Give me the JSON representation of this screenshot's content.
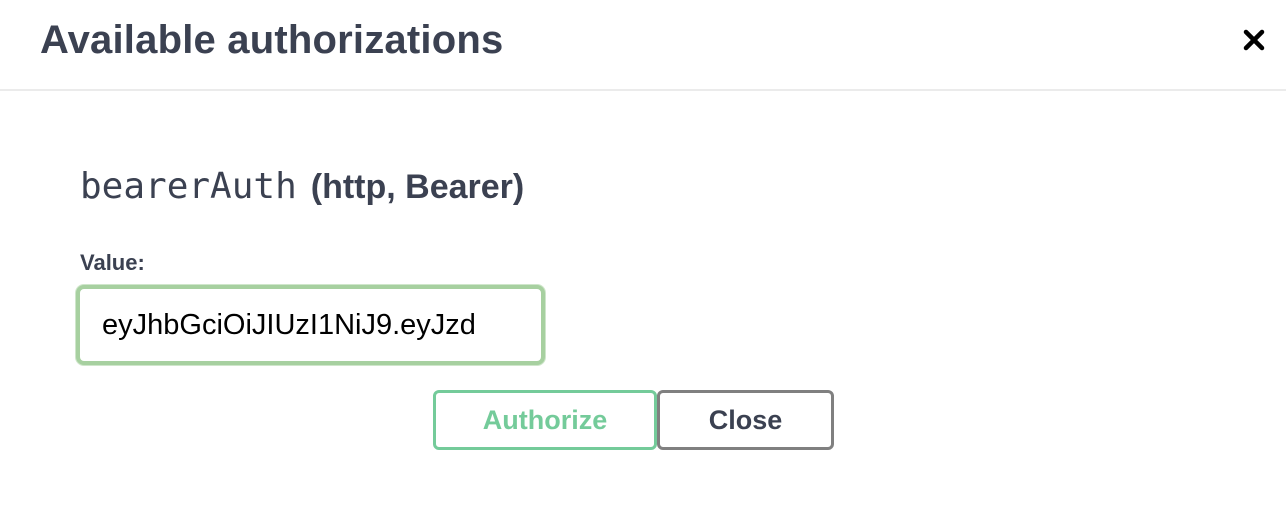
{
  "modal": {
    "title": "Available authorizations",
    "close_icon": "close-icon"
  },
  "auth": {
    "scheme_name": "bearerAuth",
    "scheme_type": "(http, Bearer)",
    "value_label": "Value:",
    "value": "eyJhbGciOiJIUzI1NiJ9.eyJzd"
  },
  "buttons": {
    "authorize_label": "Authorize",
    "close_label": "Close"
  },
  "colors": {
    "text": "#3b4151",
    "authorize_green": "#74cb9a",
    "input_border": "#a7d0a0",
    "close_border": "#808080"
  }
}
